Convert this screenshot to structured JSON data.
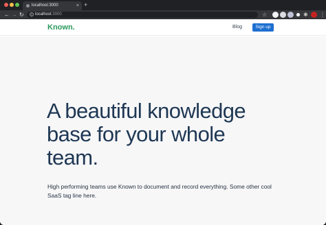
{
  "browser": {
    "tab": {
      "title": "localhost:3000",
      "close_glyph": "×"
    },
    "new_tab_glyph": "+",
    "nav": {
      "back": "←",
      "forward": "→",
      "reload": "↻"
    },
    "address": {
      "host": "localhost",
      "port": ":3000"
    },
    "bookmark_glyph": "☆",
    "extensions_glyph": "✱",
    "menu_glyph": "⋮"
  },
  "site": {
    "logo": "Known.",
    "nav": {
      "blog": "Blog",
      "signup": "Sign up"
    }
  },
  "hero": {
    "headline": "A beautiful knowledge base for your whole team.",
    "tagline": "High performing teams use Known to document and record everything. Some other cool SaaS tag line here."
  },
  "colors": {
    "logo": "#2a9a5c",
    "signup_button": "#1d6fd1",
    "headline": "#1e3753"
  }
}
